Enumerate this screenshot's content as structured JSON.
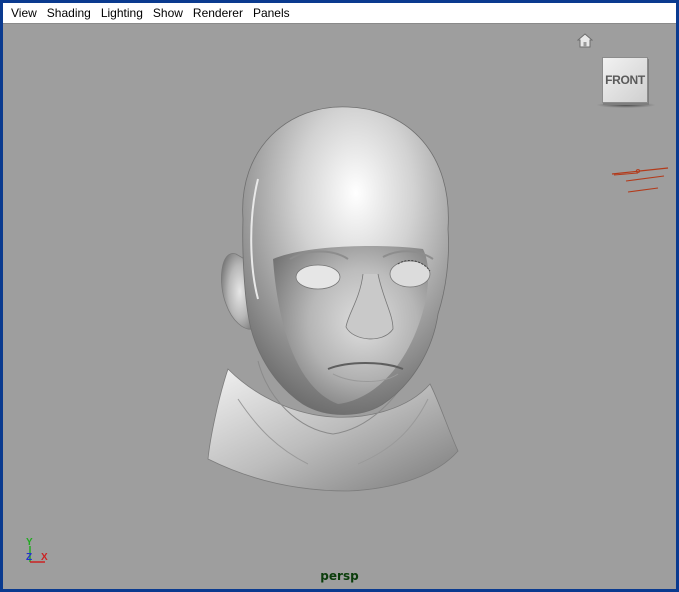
{
  "menu": {
    "items": [
      "View",
      "Shading",
      "Lighting",
      "Show",
      "Renderer",
      "Panels"
    ]
  },
  "viewcube": {
    "face_label": "FRONT"
  },
  "axis_indicator": {
    "y_label": "Y",
    "z_label": "Z",
    "x_label": "X"
  },
  "camera_label": "persp",
  "icons": [
    "home-icon",
    "viewcube",
    "axis-gizmo"
  ],
  "colors": {
    "viewport_bg": "#9e9e9e",
    "frame_border": "#0a3a8f",
    "axis_x": "#cc2222",
    "axis_y": "#22aa22",
    "axis_z": "#2233cc",
    "camera_label": "#0b3d0b"
  }
}
